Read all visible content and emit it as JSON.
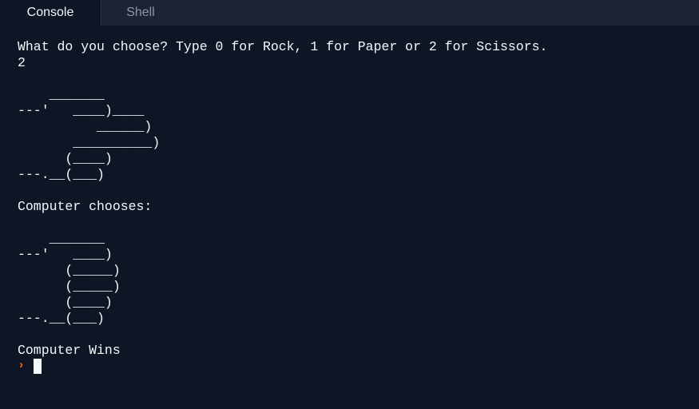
{
  "tabs": {
    "console": "Console",
    "shell": "Shell"
  },
  "console": {
    "output": "What do you choose? Type 0 for Rock, 1 for Paper or 2 for Scissors.\n2\n\n    _______\n---'   ____)____\n          ______)\n       __________)\n      (____)\n---.__(___)\n\nComputer chooses:\n\n    _______\n---'   ____)\n      (_____)\n      (_____)\n      (____)\n---.__(___)\n\nComputer Wins",
    "prompt_symbol": "›"
  },
  "colors": {
    "background": "#0e1525",
    "tabbar": "#1c2333",
    "text": "#f5f9fc",
    "prompt": "#f26207"
  }
}
